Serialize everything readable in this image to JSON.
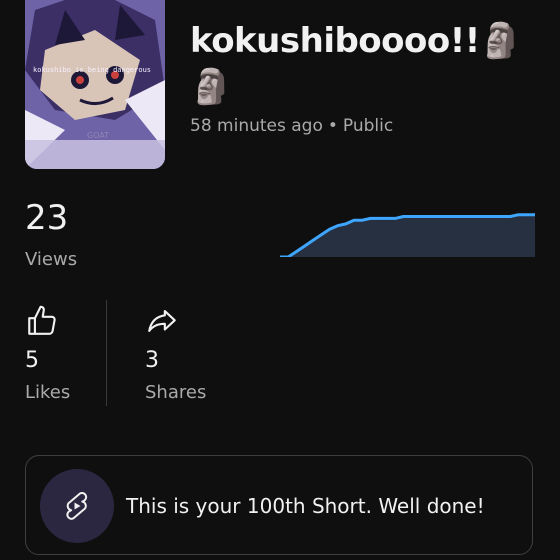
{
  "video": {
    "title": "kokushiboooo!!🗿🗿",
    "time_ago": "58 minutes ago",
    "separator": "•",
    "visibility": "Public",
    "thumbnail_overlay_text": "kokushibo is being dangerous",
    "thumbnail_watermark": "GOAT"
  },
  "views": {
    "count": "23",
    "label": "Views"
  },
  "views_graph": {
    "type": "line",
    "color": "#3ea6ff",
    "fill": "#263040",
    "values": [
      0,
      0,
      3,
      6,
      9,
      12,
      15,
      17,
      18,
      20,
      20,
      21,
      21,
      21,
      21,
      22,
      22,
      22,
      22,
      22,
      22,
      22,
      22,
      22,
      22,
      22,
      22,
      22,
      22,
      23,
      23,
      23
    ],
    "ylim": [
      0,
      25
    ]
  },
  "likes": {
    "count": "5",
    "label": "Likes",
    "icon": "thumb-up-icon"
  },
  "shares": {
    "count": "3",
    "label": "Shares",
    "icon": "share-arrow-icon"
  },
  "milestone": {
    "message": "This is your 100th Short. Well done!",
    "icon": "shorts-logo-icon"
  },
  "colors": {
    "background": "#0f0f0f",
    "text": "#f1f1f1",
    "secondary": "#aaaaaa",
    "accent": "#3ea6ff"
  }
}
